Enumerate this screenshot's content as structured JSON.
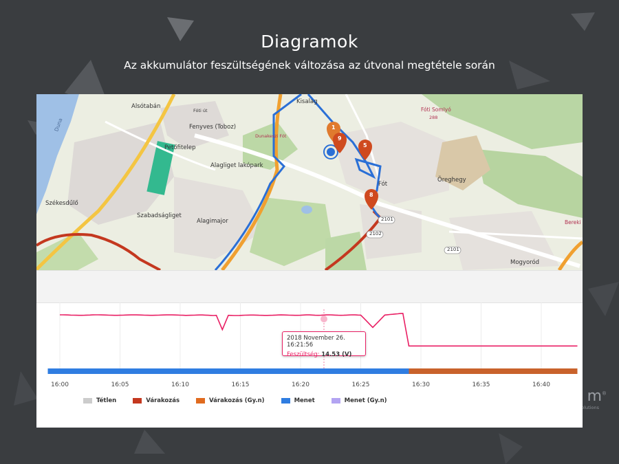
{
  "header": {
    "title": "Diagramok",
    "subtitle": "Az akkumulátor feszültségének változása az útvonal megtétele során"
  },
  "map": {
    "place_labels": [
      "Alsótabán",
      "Kisalag",
      "Fenyves (Toboz)",
      "Petőfitelep",
      "Alagliget lakópark",
      "Fót",
      "Öreghegy",
      "Székesdűlő",
      "Szabadságliget",
      "Alagimajor",
      "Mogyoród",
      "Fóti Somlyó",
      "Dunakeszi Fót",
      "Duna",
      "Fóti út",
      "Bereki"
    ],
    "road_numbers": [
      "2101",
      "2102",
      "2101",
      "288"
    ],
    "markers": [
      "1",
      "9",
      "5",
      "8"
    ],
    "marker_color": "#cf4a1f",
    "route_color": "#2a6fd6",
    "track_color": "#c4381f"
  },
  "chart": {
    "line_color": "#e91e63",
    "tooltip": {
      "date": "2018 November 26. 16:21:56",
      "label": "Feszültség:",
      "value": "14.53 (V)"
    },
    "x_tick_labels": [
      "16:00",
      "16:05",
      "16:10",
      "16:15",
      "16:20",
      "16:25",
      "16:30",
      "16:35",
      "16:40"
    ],
    "legend": [
      {
        "label": "Tétlen",
        "color": "#cccccc"
      },
      {
        "label": "Várakozás",
        "color": "#c4381f"
      },
      {
        "label": "Várakozás (Gy.n)",
        "color": "#e06b1f"
      },
      {
        "label": "Menet",
        "color": "#2f7de1"
      },
      {
        "label": "Menet (Gy.n)",
        "color": "#b3a4f2"
      }
    ]
  },
  "chart_data": {
    "type": "line",
    "title": "",
    "xlabel": "",
    "ylabel": "",
    "x_unit": "time",
    "series": [
      {
        "name": "Feszültség",
        "points": [
          [
            "16:00",
            14.53
          ],
          [
            "16:05",
            14.53
          ],
          [
            "16:10",
            14.53
          ],
          [
            "16:13",
            14.52
          ],
          [
            "16:13:30",
            13.9
          ],
          [
            "16:14",
            14.52
          ],
          [
            "16:20",
            14.53
          ],
          [
            "16:21:56",
            14.53
          ],
          [
            "16:25",
            14.53
          ],
          [
            "16:26",
            14.0
          ],
          [
            "16:27",
            14.53
          ],
          [
            "16:28:30",
            14.6
          ],
          [
            "16:29",
            13.2
          ],
          [
            "16:35",
            13.2
          ],
          [
            "16:40",
            13.2
          ],
          [
            "16:43",
            13.2
          ]
        ]
      }
    ],
    "state_bar": [
      {
        "state": "Menet",
        "from": "15:59",
        "to": "16:29"
      },
      {
        "state": "Várakozás (Gy.n)",
        "from": "16:29",
        "to": "16:43"
      }
    ],
    "grid": true
  },
  "brand": {
    "logo_fragment": "m",
    "registered": "®",
    "tagline_fragment": "olutions"
  }
}
